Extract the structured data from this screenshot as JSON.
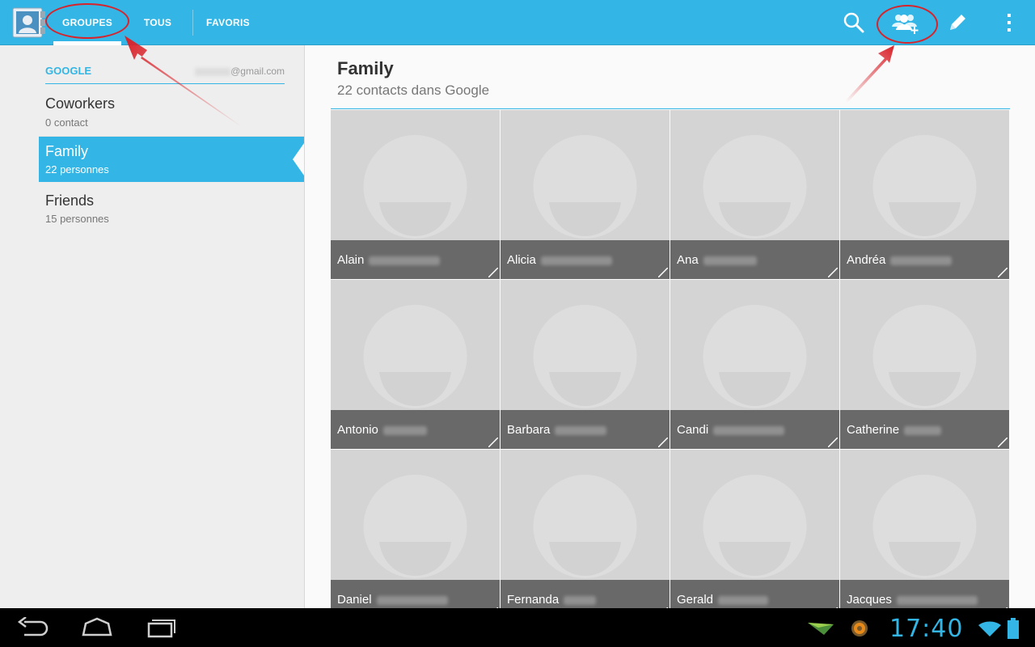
{
  "action_bar": {
    "tabs": [
      {
        "label": "GROUPES",
        "selected": true
      },
      {
        "label": "TOUS",
        "selected": false
      },
      {
        "label": "FAVORIS",
        "selected": false
      }
    ],
    "actions": [
      "search-icon",
      "add-group-icon",
      "edit-icon",
      "overflow-menu-icon"
    ],
    "color": "#33b5e5"
  },
  "account": {
    "type": "GOOGLE",
    "email_domain": "@gmail.com"
  },
  "groups": [
    {
      "name": "Coworkers",
      "count": "0 contact",
      "selected": false
    },
    {
      "name": "Family",
      "count": "22 personnes",
      "selected": true
    },
    {
      "name": "Friends",
      "count": "15 personnes",
      "selected": false
    }
  ],
  "group_detail": {
    "title": "Family",
    "subtitle": "22 contacts dans Google"
  },
  "contacts": [
    {
      "first": "Alain"
    },
    {
      "first": "Alicia"
    },
    {
      "first": "Ana"
    },
    {
      "first": "Andréa"
    },
    {
      "first": "Antonio"
    },
    {
      "first": "Barbara"
    },
    {
      "first": "Candi"
    },
    {
      "first": "Catherine"
    },
    {
      "first": "Daniel"
    },
    {
      "first": "Fernanda"
    },
    {
      "first": "Gerald"
    },
    {
      "first": "Jacques"
    }
  ],
  "system_bar": {
    "clock": "17:40",
    "clock_color": "#33b5e5"
  },
  "annotation_color": "#d9232b"
}
